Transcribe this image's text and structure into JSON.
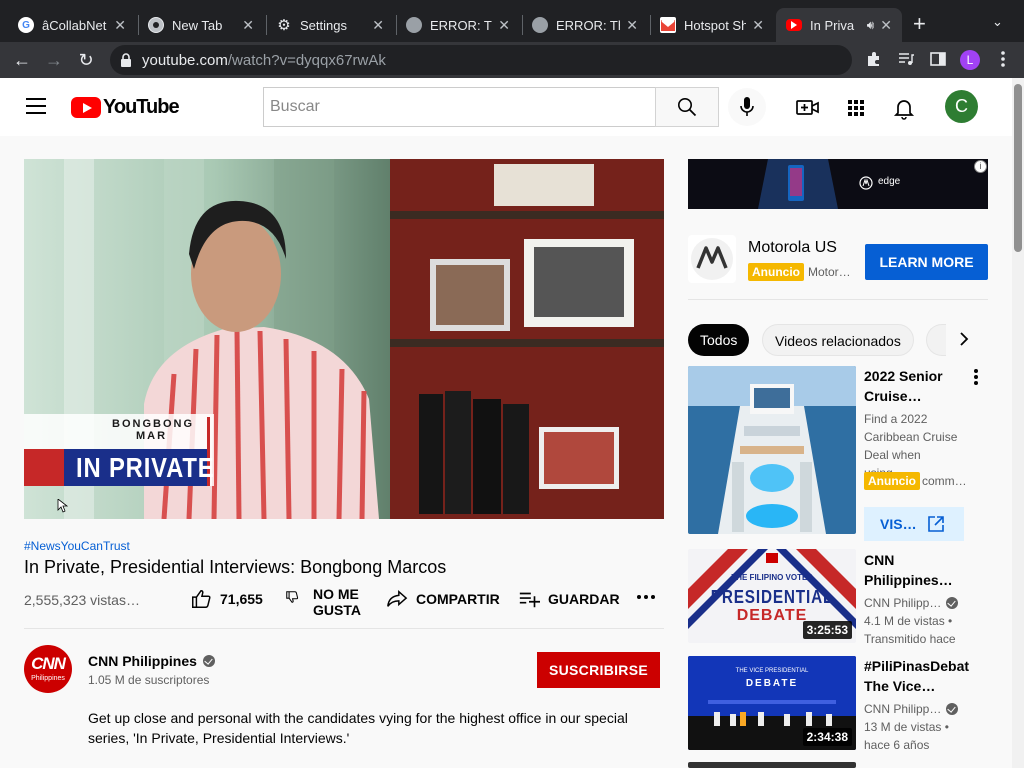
{
  "browser": {
    "tabs": [
      {
        "label": "âCollabNet",
        "icon": "google-icon"
      },
      {
        "label": "New Tab",
        "icon": "chrome-icon"
      },
      {
        "label": "Settings",
        "icon": "gear-icon"
      },
      {
        "label": "ERROR: Th",
        "icon": "globe-icon"
      },
      {
        "label": "ERROR: Th",
        "icon": "globe-icon"
      },
      {
        "label": "Hotspot Sh",
        "icon": "gmail-icon"
      },
      {
        "label": "In Priva",
        "icon": "youtube-icon"
      }
    ],
    "url_host": "youtube.com",
    "url_path": "/watch?v=dyqqx67rwAk",
    "profile_initial": "L"
  },
  "masthead": {
    "logo_text": "YouTube",
    "search_placeholder": "Buscar",
    "avatar_initial": "C"
  },
  "video": {
    "overlay_line1": "BONGBONG",
    "overlay_line2": "MAR",
    "overlay_line3": "IN PRIVATE",
    "hashtag": "#NewsYouCanTrust",
    "title": "In Private, Presidential Interviews: Bongbong Marcos",
    "views": "2,555,323 vistas…",
    "like_count": "71,655",
    "dislike_label_1": "NO ME",
    "dislike_label_2": "GUSTA",
    "share_label": "COMPARTIR",
    "save_label": "GUARDAR"
  },
  "channel": {
    "name": "CNN Philippines",
    "subscribers": "1.05 M de suscriptores",
    "subscribe_label": "SUSCRIBIRSE",
    "logo_text": "CNN",
    "logo_sub": "Philippines",
    "description": "Get up close and personal with the candidates vying for the highest office in our special series, 'In Private, Presidential Interviews.'"
  },
  "sidebar": {
    "banner_brand": "edge",
    "ad_name": "Motorola US",
    "ad_badge": "Anuncio",
    "ad_sub": "Motor…",
    "learn_more": "LEARN MORE",
    "chips": [
      "Todos",
      "Videos relacionados"
    ],
    "items": [
      {
        "title_1": "2022 Senior",
        "title_2": "Cruise…",
        "desc_1": "Find a 2022",
        "desc_2": "Caribbean Cruise",
        "desc_3": "Deal when using…",
        "badge": "Anuncio",
        "meta": "comm…",
        "button": "VIS…"
      },
      {
        "title_1": "CNN",
        "title_2": "Philippines…",
        "channel": "CNN Philipp…",
        "views": "4.1 M de vistas •",
        "time": "Transmitido hace",
        "duration": "3:25:53",
        "thumb_line1": "THE FILIPINO VOTES",
        "thumb_line2": "PRESIDENTIAL",
        "thumb_line3": "DEBATE"
      },
      {
        "title_1": "#PiliPinasDebat",
        "title_2": "The Vice…",
        "channel": "CNN Philipp…",
        "views": "13 M de vistas •",
        "time": "hace 6 años",
        "duration": "2:34:38",
        "thumb_line1": "THE VICE PRESIDENTIAL",
        "thumb_line2": "DEBATE"
      }
    ]
  },
  "colors": {
    "youtube_red": "#ff0000",
    "subscribe_red": "#cc0000",
    "link_blue": "#065fd4",
    "ad_yellow": "#f5b800",
    "chrome_dark": "#202124"
  }
}
